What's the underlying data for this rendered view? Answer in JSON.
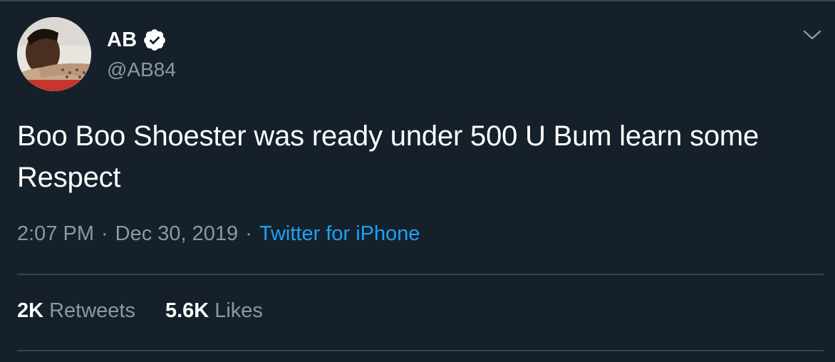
{
  "author": {
    "display_name": "AB",
    "handle": "@AB84",
    "verified_icon": "verified-badge-icon",
    "avatar_icon": "profile-photo"
  },
  "tweet": {
    "text": "Boo Boo Shoester was ready under 500 U Bum learn some Respect"
  },
  "meta": {
    "time": "2:07 PM",
    "separator": "·",
    "date": "Dec 30, 2019",
    "source": "Twitter for iPhone"
  },
  "stats": {
    "retweets_count": "2K",
    "retweets_label": "Retweets",
    "likes_count": "5.6K",
    "likes_label": "Likes"
  },
  "colors": {
    "background": "#15202b",
    "text": "#ffffff",
    "secondary_text": "#8899a6",
    "accent": "#1da1f2",
    "divider": "#38444d"
  }
}
